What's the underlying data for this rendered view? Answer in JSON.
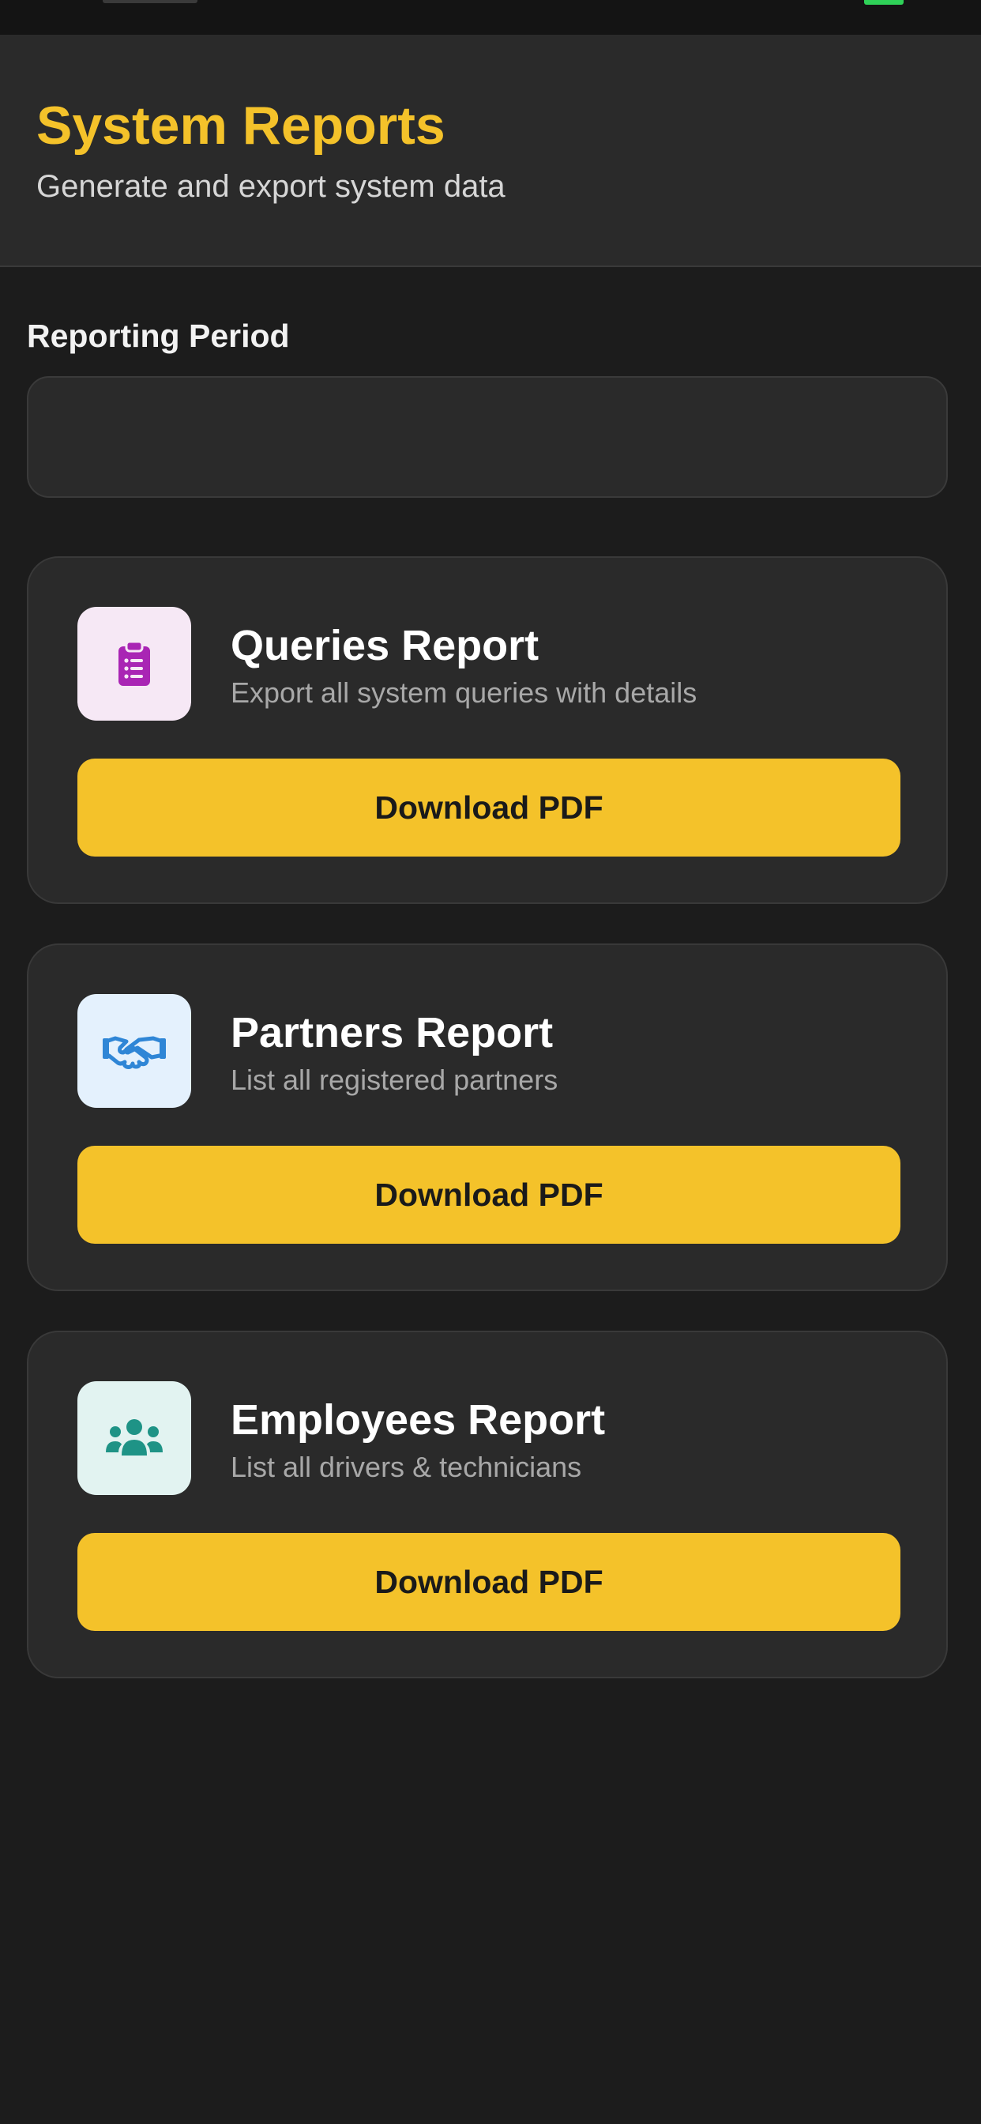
{
  "header": {
    "title": "System Reports",
    "subtitle": "Generate and export system data"
  },
  "reporting_period": {
    "label": "Reporting Period",
    "value": ""
  },
  "reports": [
    {
      "title": "Queries Report",
      "description": "Export all system queries with details",
      "icon": "clipboard-list-icon",
      "icon_bg": "#f6e8f5",
      "icon_color": "#a925b4",
      "button_label": "Download PDF"
    },
    {
      "title": "Partners Report",
      "description": "List all registered partners",
      "icon": "handshake-icon",
      "icon_bg": "#e4f1fd",
      "icon_color": "#2f86d6",
      "button_label": "Download PDF"
    },
    {
      "title": "Employees Report",
      "description": "List all drivers & technicians",
      "icon": "users-group-icon",
      "icon_bg": "#e2f3f1",
      "icon_color": "#1e9386",
      "button_label": "Download PDF"
    }
  ],
  "colors": {
    "accent": "#f4c22a",
    "background": "#1c1c1c",
    "card": "#2a2a2a"
  }
}
